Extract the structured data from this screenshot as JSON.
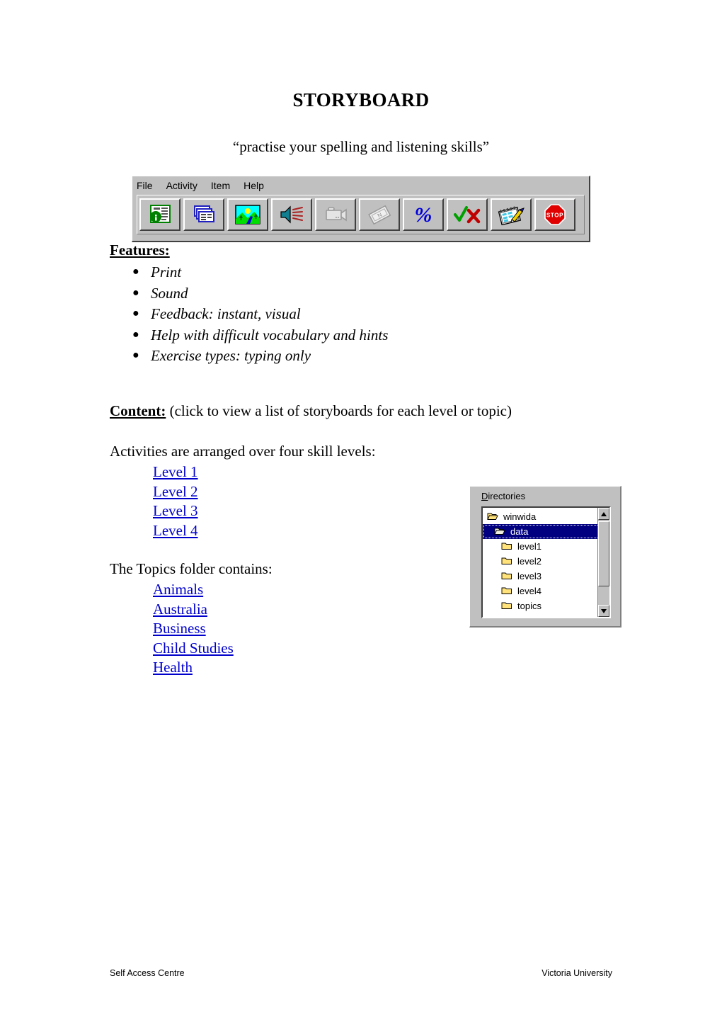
{
  "document": {
    "title": "STORYBOARD",
    "subtitle": "“practise your spelling and listening skills”"
  },
  "app_window": {
    "menu": [
      {
        "label": "File"
      },
      {
        "label": "Activity"
      },
      {
        "label": "Item"
      },
      {
        "label": "Help"
      }
    ],
    "toolbar_buttons": [
      {
        "name": "info-document-icon",
        "tooltip": "Information"
      },
      {
        "name": "stacked-cards-icon",
        "tooltip": "Cards"
      },
      {
        "name": "picture-icon",
        "tooltip": "Picture"
      },
      {
        "name": "speaker-sound-icon",
        "tooltip": "Sound"
      },
      {
        "name": "video-camera-icon",
        "tooltip": "Video",
        "disabled": true
      },
      {
        "name": "ribbon-tag-icon",
        "tooltip": "Tag",
        "disabled": true
      },
      {
        "name": "percent-icon",
        "tooltip": "Score"
      },
      {
        "name": "check-cross-icon",
        "tooltip": "Check answers"
      },
      {
        "name": "notepad-pencil-icon",
        "tooltip": "Write"
      },
      {
        "name": "stop-sign-icon",
        "label": "STOP",
        "tooltip": "Stop"
      }
    ]
  },
  "features": {
    "heading": "Features:",
    "bullet_glyph": "●",
    "items": [
      "Print",
      "Sound",
      "Feedback: instant, visual",
      "Help with difficult vocabulary and hints",
      "Exercise types: typing only"
    ]
  },
  "content": {
    "label": "Content:",
    "note": " (click to view a list of storyboards for each level or topic)",
    "activities_line": "Activities are arranged over four skill levels:",
    "levels": [
      "Level 1",
      "Level 2",
      "Level 3",
      "Level 4"
    ],
    "topics_line": "The Topics folder contains:",
    "topics": [
      "Animals",
      "Australia",
      "Business",
      "Child Studies",
      "Health"
    ]
  },
  "directories_dialog": {
    "label_accesskey": "D",
    "label_rest": "irectories",
    "items": [
      {
        "name": "winwida",
        "icon": "open-folder-icon",
        "depth": 1,
        "selected": false
      },
      {
        "name": "data",
        "icon": "open-folder-icon",
        "depth": 2,
        "selected": true
      },
      {
        "name": "level1",
        "icon": "closed-folder-icon",
        "depth": 3,
        "selected": false
      },
      {
        "name": "level2",
        "icon": "closed-folder-icon",
        "depth": 3,
        "selected": false
      },
      {
        "name": "level3",
        "icon": "closed-folder-icon",
        "depth": 3,
        "selected": false
      },
      {
        "name": "level4",
        "icon": "closed-folder-icon",
        "depth": 3,
        "selected": false
      },
      {
        "name": "topics",
        "icon": "closed-folder-icon",
        "depth": 3,
        "selected": false
      }
    ]
  },
  "footer": {
    "left": "Self Access Centre",
    "right": "Victoria University"
  },
  "colors": {
    "link": "#0000cc",
    "selection": "#000080",
    "chrome": "#c0c0c0",
    "folder": "#ffe27a",
    "stop_red": "#e00000"
  }
}
